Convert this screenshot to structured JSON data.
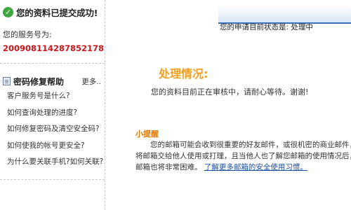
{
  "sidebar": {
    "success_text": "您的资料已提交成功!",
    "service_label": "您的服务号为:",
    "service_number": "200908114287852178",
    "help": {
      "title": "密码修复帮助",
      "more": "更多..",
      "items": [
        "客户服务号是什么?",
        "如何查询处理的进度?",
        "如何修复密码及清空安全码?",
        "如何使我的帐号更安全?",
        "为什么要关联手机?如何关联?"
      ]
    }
  },
  "main": {
    "status_text": "您的申请目前状态是: 处理中",
    "heading": "处理情况:",
    "waiting_text": "您的资料目前正在审核中，请耐心等待。谢谢!",
    "tip": {
      "title": "小提醒",
      "line1": "您的邮箱可能会收到很重要的好友邮件，或很机密的商业邮件，",
      "line2": "将邮箱交给他人使用或打理，且当他人也了解您邮箱的使用情况后，",
      "line3": "邮箱也将非常困难。",
      "link": "了解更多邮箱的安全使用习惯。"
    }
  },
  "colors": {
    "accent_orange": "#f0a020",
    "service_number_red": "#d0161d",
    "link_blue": "#1a4fa0",
    "success_green": "#3ea83e"
  }
}
